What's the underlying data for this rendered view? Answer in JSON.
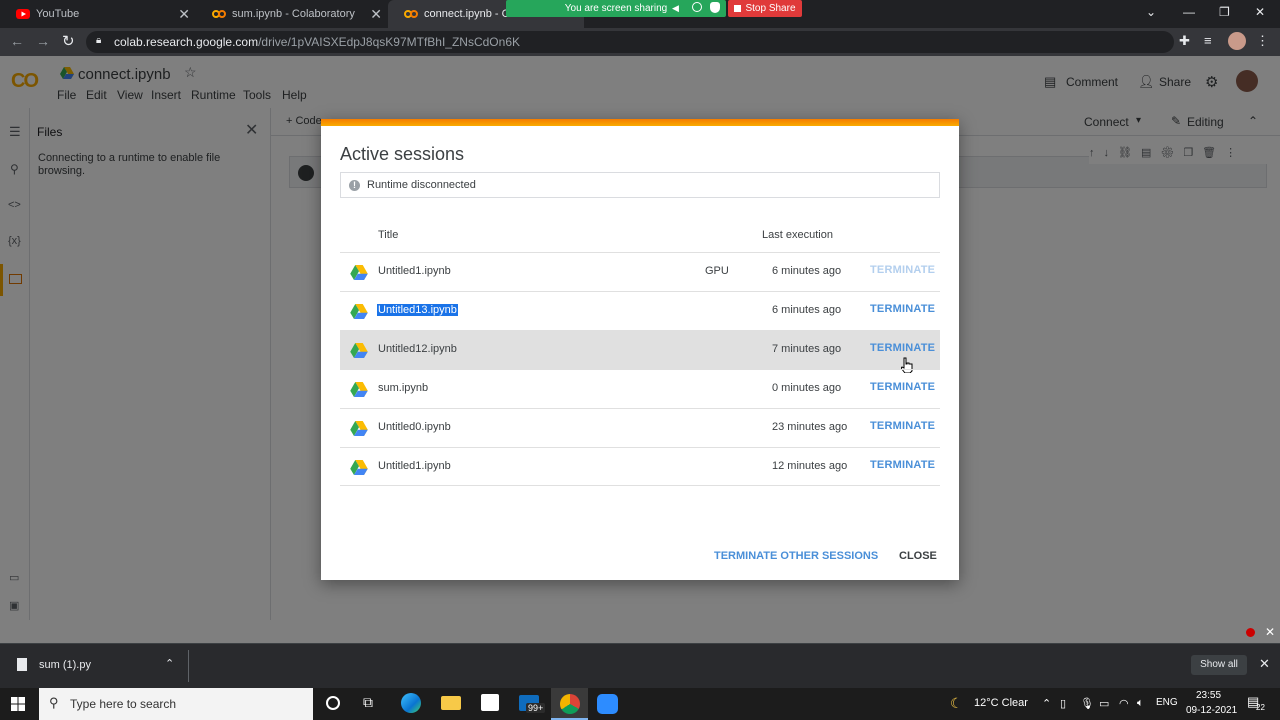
{
  "browser": {
    "tabs": [
      {
        "title": "YouTube"
      },
      {
        "title": "sum.ipynb - Colaboratory"
      },
      {
        "title": "connect.ipynb - Cola"
      }
    ],
    "screen_share": {
      "text": "You are screen sharing",
      "stop_label": "Stop Share"
    },
    "url_host": "colab.research.google.com",
    "url_path": "/drive/1pVAISXEdpJ8qsK97MTfBhI_ZNsCdOn6K"
  },
  "colab": {
    "logo": "CO",
    "notebook_title": "connect.ipynb",
    "menu": [
      "File",
      "Edit",
      "View",
      "Insert",
      "Runtime",
      "Tools",
      "Help"
    ],
    "comment_label": "Comment",
    "share_label": "Share",
    "add_code_label": "+ Code",
    "connect_label": "Connect",
    "editing_label": "Editing",
    "files_panel": {
      "title": "Files",
      "message": "Connecting to a runtime to enable file browsing."
    }
  },
  "dialog": {
    "title": "Active sessions",
    "status": "Runtime disconnected",
    "col_title": "Title",
    "col_last_execution": "Last execution",
    "sessions": [
      {
        "title": "Untitled1.ipynb",
        "accel": "GPU",
        "last": "6 minutes ago",
        "action": "TERMINATE"
      },
      {
        "title": "Untitled13.ipynb",
        "accel": "",
        "last": "6 minutes ago",
        "action": "TERMINATE"
      },
      {
        "title": "Untitled12.ipynb",
        "accel": "",
        "last": "7 minutes ago",
        "action": "TERMINATE"
      },
      {
        "title": "sum.ipynb",
        "accel": "",
        "last": "0 minutes ago",
        "action": "TERMINATE"
      },
      {
        "title": "Untitled0.ipynb",
        "accel": "",
        "last": "23 minutes ago",
        "action": "TERMINATE"
      },
      {
        "title": "Untitled1.ipynb",
        "accel": "",
        "last": "12 minutes ago",
        "action": "TERMINATE"
      }
    ],
    "terminate_other_label": "TERMINATE OTHER SESSIONS",
    "close_label": "CLOSE"
  },
  "downloads": {
    "file": "sum (1).py",
    "show_all_label": "Show all"
  },
  "taskbar": {
    "search_placeholder": "Type here to search",
    "mail_badge": "99+",
    "weather": "12°C  Clear",
    "lang": "ENG",
    "time": "23:55",
    "date": "09-12-2021",
    "notif_count": "22"
  },
  "colors": {
    "colab_orange": "#f9ab00",
    "link_blue": "#4a8fd8",
    "selection_blue": "#1a73e8"
  }
}
